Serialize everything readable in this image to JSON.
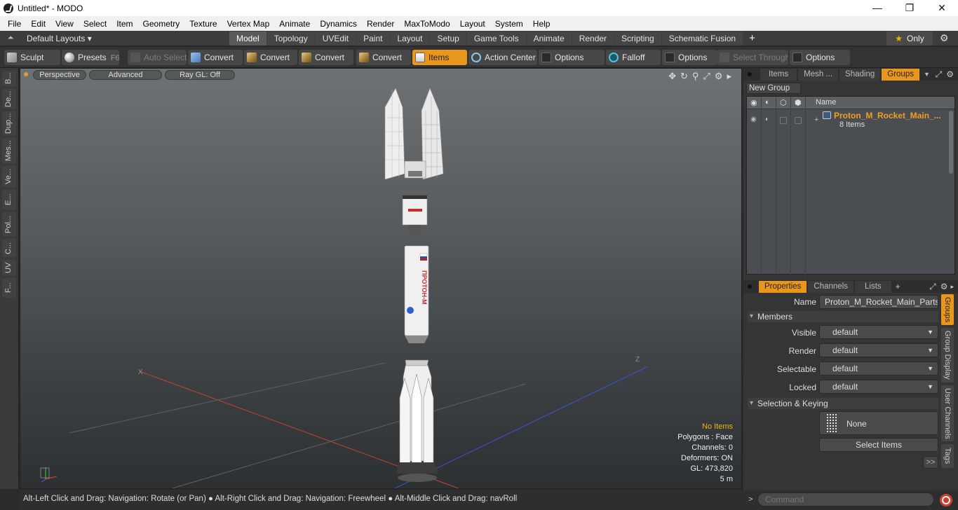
{
  "window": {
    "title": "Untitled* - MODO",
    "min": "—",
    "max": "❐",
    "close": "✕"
  },
  "menu": [
    "File",
    "Edit",
    "View",
    "Select",
    "Item",
    "Geometry",
    "Texture",
    "Vertex Map",
    "Animate",
    "Dynamics",
    "Render",
    "MaxToModo",
    "Layout",
    "System",
    "Help"
  ],
  "layout": {
    "default_layouts": "Default Layouts ▾",
    "tabs": [
      "Model",
      "Topology",
      "UVEdit",
      "Paint",
      "Layout",
      "Setup",
      "Game Tools",
      "Animate",
      "Render",
      "Scripting",
      "Schematic Fusion"
    ],
    "active_tab": "Model",
    "plus": "+",
    "only": "Only"
  },
  "toolbar": {
    "sculpt": "Sculpt",
    "presets": "Presets",
    "presets_key": "F6",
    "auto_select": "Auto Select",
    "convert1": "Convert",
    "convert2": "Convert",
    "convert3": "Convert",
    "convert4": "Convert",
    "items": "Items",
    "action_center": "Action Center",
    "options1": "Options",
    "falloff": "Falloff",
    "options2": "Options",
    "select_through": "Select Through",
    "options3": "Options"
  },
  "left_tabs": [
    "B...",
    "De...",
    "Dup...",
    "Mes...",
    "Ve...",
    "E...",
    "Pol...",
    "C...",
    "UV",
    "F..."
  ],
  "viewport": {
    "perspective": "Perspective",
    "advanced": "Advanced",
    "raygl": "Ray GL: Off",
    "info": {
      "no_items": "No Items",
      "polygons": "Polygons : Face",
      "channels": "Channels: 0",
      "deformers": "Deformers: ON",
      "gl": "GL: 473,820",
      "scale": "5 m"
    },
    "rocket_text": "ПРОТОН-М",
    "axis_x": "X",
    "axis_z": "Z"
  },
  "status": "Alt-Left Click and Drag: Navigation: Rotate (or Pan) ● Alt-Right Click and Drag: Navigation: Freewheel ● Alt-Middle Click and Drag: navRoll",
  "groups_panel": {
    "tabs": [
      "Items",
      "Mesh ...",
      "Shading",
      "Groups"
    ],
    "active": "Groups",
    "new_group": "New Group",
    "col_name": "Name",
    "group_name": "Proton_M_Rocket_Main_...",
    "group_count": "8 Items"
  },
  "props_panel": {
    "tabs": [
      "Properties",
      "Channels",
      "Lists"
    ],
    "active": "Properties",
    "plus": "+",
    "name_label": "Name",
    "name_value": "Proton_M_Rocket_Main_Parts (1",
    "members": "Members",
    "visible_label": "Visible",
    "visible_value": "default",
    "render_label": "Render",
    "render_value": "default",
    "selectable_label": "Selectable",
    "selectable_value": "default",
    "locked_label": "Locked",
    "locked_value": "default",
    "sel_keying": "Selection & Keying",
    "none_btn": "None",
    "select_items_btn": "Select Items",
    "more": ">>"
  },
  "right_vtabs": [
    "Groups",
    "Group Display",
    "User Channels",
    "Tags"
  ],
  "command": {
    "placeholder": "Command",
    "prompt": ">"
  },
  "colors": {
    "accent": "#e8961c",
    "bg": "#353535"
  }
}
